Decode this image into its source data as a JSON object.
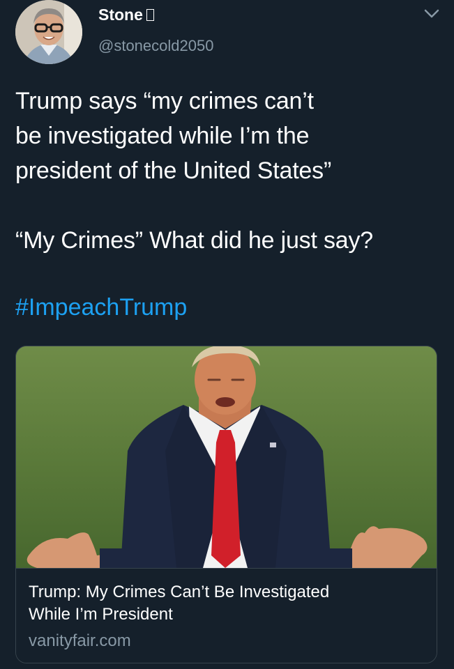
{
  "tweet": {
    "display_name": "Stone",
    "name_glyph": "missing-glyph-box",
    "handle": "@stonecold2050",
    "caret_icon": "chevron-down-icon",
    "text_lines": [
      "Trump says “my crimes can’t",
      "be investigated while I’m the",
      "president of the United States”",
      "“My Crimes” What did he just say?"
    ],
    "hashtag": "#ImpeachTrump"
  },
  "card": {
    "image_icon": "photo-of-speaker-icon",
    "title_lines": [
      "Trump: My Crimes Can’t Be Investigated",
      "While I’m President"
    ],
    "domain": "vanityfair.com"
  },
  "colors": {
    "background": "#15202b",
    "text_primary": "#ffffff",
    "text_secondary": "#8899a6",
    "link": "#1da1f2",
    "border": "#38444d"
  }
}
